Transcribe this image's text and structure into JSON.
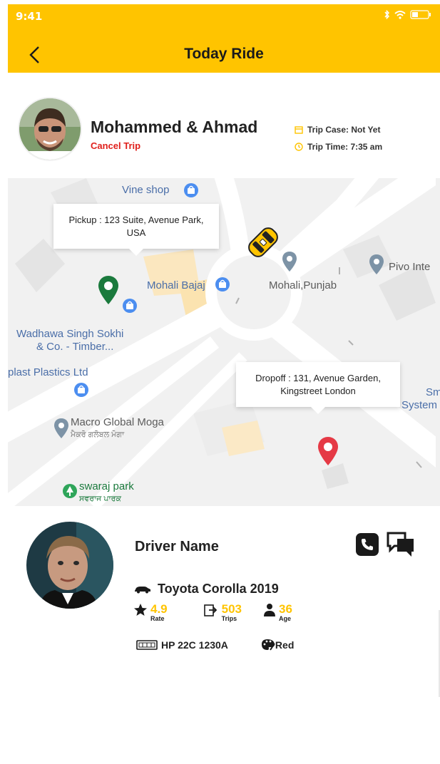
{
  "status_bar": {
    "time": "9:41"
  },
  "header": {
    "title": "Today Ride",
    "back_icon": "chevron-left-icon"
  },
  "ride": {
    "rider_names": "Mohammed & Ahmad",
    "cancel_label": "Cancel Trip",
    "trip_case_label": "Trip Case: Not Yet",
    "trip_time_label": "Trip Time: 7:35 am"
  },
  "map": {
    "pickup": "Pickup : 123 Suite, Avenue Park, USA",
    "dropoff": "Dropoff : 131, Avenue Garden, Kingstreet London",
    "places": {
      "vine_shop": "Vine shop",
      "mohali_bajaj": "Mohali Bajaj",
      "mohali_punjab": "Mohali,Punjab",
      "pivo": "Pivo Inte",
      "wadhawa_1": "Wadhawa Singh Sokhi",
      "wadhawa_2": "& Co. - Timber...",
      "plastics": "plast Plastics Ltd",
      "macro": "Macro Global Moga",
      "macro_sub": "ਮੈਕਰੋ ਗਲੋਬਲ ਮੋਗਾ",
      "sm_1": "Sm",
      "sm_2": "System",
      "swaraj": "swaraj park",
      "swaraj_sub": "ਸਵਰਾਜ ਪਾਰਕ"
    }
  },
  "driver": {
    "name": "Driver Name",
    "car": "Toyota Corolla  2019",
    "rate": "4.9",
    "rate_label": "Rate",
    "trips": "503",
    "trips_label": "Trips",
    "age": "36",
    "age_label": "Age",
    "plate": "HP 22C 1230A",
    "color": "Red"
  },
  "colors": {
    "accent": "#ffc400",
    "cancel": "#e0201c",
    "pickup_pin": "#1b7a3d",
    "dropoff_pin": "#e53945"
  }
}
